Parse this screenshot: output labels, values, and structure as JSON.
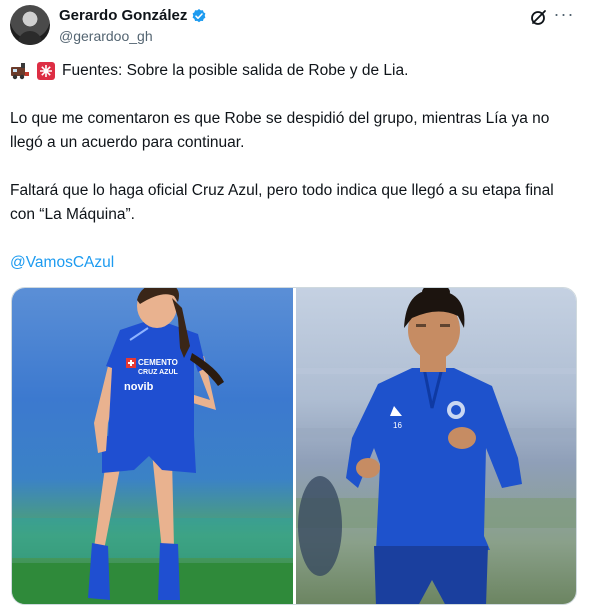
{
  "author": {
    "display_name": "Gerardo González",
    "handle": "@gerardoo_gh",
    "verified": true
  },
  "actions": {
    "grok_icon": "grok-icon",
    "more_icon": "more-icon",
    "more_glyph": "···"
  },
  "tweet": {
    "line1": "Fuentes: Sobre la posible salida de Robe y de Lia.",
    "line1_emojis": [
      "train-emoji",
      "sos-emoji"
    ],
    "paragraph2": "Lo que me comentaron es que Robe se despidió del grupo, mientras Lía ya no llegó a un acuerdo para continuar.",
    "paragraph3": "Faltará que lo haga oficial Cruz Azul, pero todo indica que llegó a su etapa final con “La Máquina”.",
    "mention": "@VamosCAzul"
  },
  "media": {
    "photo1_jersey_text1": "CEMENTO",
    "photo1_jersey_text2": "CRUZ AZUL",
    "photo1_sponsor": "novib",
    "photo2_number": "16"
  },
  "colors": {
    "link": "#1d9bf0",
    "verified": "#1d9bf0",
    "secondary_text": "#536471",
    "kit_blue": "#1f4fd1"
  }
}
